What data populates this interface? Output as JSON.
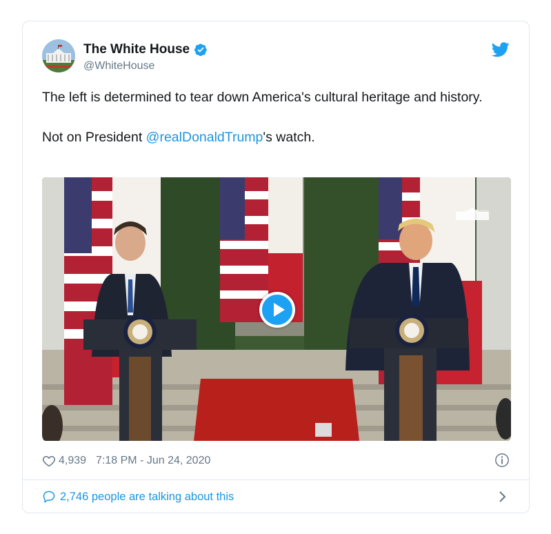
{
  "author": {
    "display_name": "The White House",
    "handle": "@WhiteHouse"
  },
  "tweet": {
    "line1": "The left is determined to tear down America's cultural heritage and history.",
    "line2_prefix": "Not on President ",
    "mention": "@realDonaldTrump",
    "line2_suffix": "'s watch."
  },
  "media": {
    "watermark": "WH.GOV"
  },
  "meta": {
    "like_count": "4,939",
    "timestamp": "7:18 PM - Jun 24, 2020"
  },
  "footer": {
    "talking": "2,746 people are talking about this"
  },
  "colors": {
    "link": "#1b95e0",
    "twitter_blue": "#1da1f2",
    "muted": "#657786",
    "border": "#e1e8ed"
  },
  "icons": [
    "white-house-avatar",
    "verified-badge-icon",
    "twitter-bird-icon",
    "play-icon",
    "heart-icon",
    "info-icon",
    "speech-bubble-icon",
    "chevron-right-icon"
  ]
}
